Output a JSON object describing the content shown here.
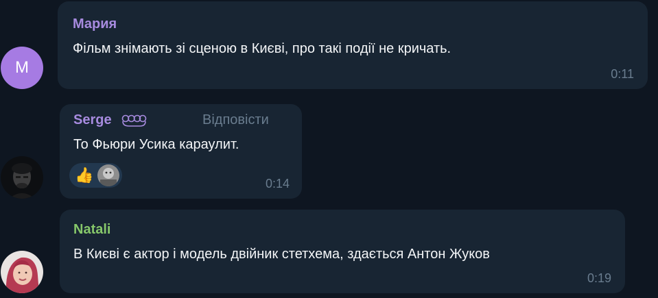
{
  "messages": [
    {
      "author": "Мария",
      "author_color": "#a78bdf",
      "avatar_letter": "M",
      "text": "Фільм знімають зі сценою в Києві, про такі події не кричать.",
      "time": "0:11"
    },
    {
      "author": "Serge",
      "author_color": "#a78bdf",
      "text": "То Фьюри Усика караулит.",
      "time": "0:14",
      "reply_label": "Відповісти",
      "reaction_emoji": "👍"
    },
    {
      "author": "Natali",
      "author_color": "#86c76a",
      "text": "В Києві є актор і модель двійник стетхема, здається Антон Жуков",
      "time": "0:19"
    }
  ]
}
